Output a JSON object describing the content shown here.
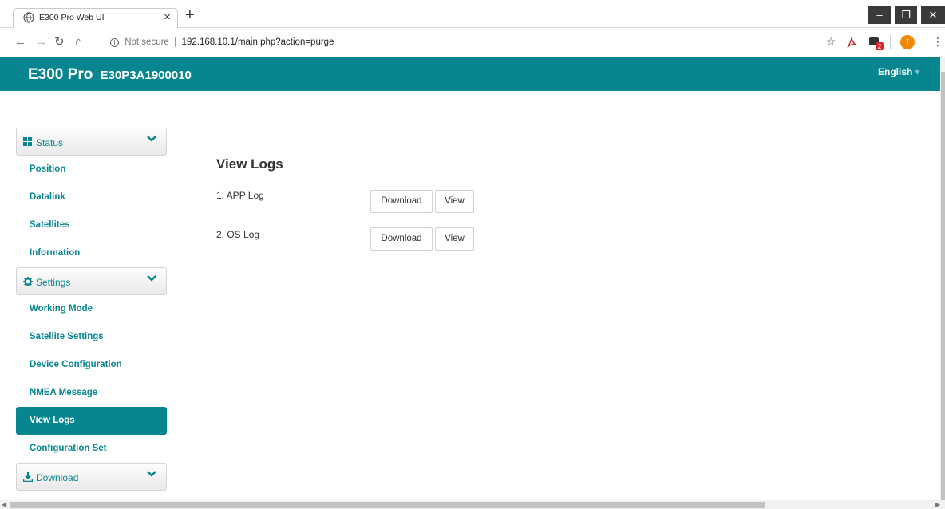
{
  "browser": {
    "tab_title": "E300 Pro Web UI",
    "tab_close": "×",
    "new_tab": "+",
    "security_label": "Not secure",
    "url": "192.168.10.1/main.php?action=purge",
    "bookmark_icon": "star-icon",
    "extension_badge": "2",
    "profile_initial": "f"
  },
  "header": {
    "product": "E300 Pro",
    "serial": "E30P3A1900010",
    "language": "English"
  },
  "sidebar": {
    "status": {
      "label": "Status",
      "items": [
        "Position",
        "Datalink",
        "Satellites",
        "Information"
      ]
    },
    "settings": {
      "label": "Settings",
      "items": [
        "Working Mode",
        "Satellite Settings",
        "Device Configuration",
        "NMEA Message",
        "View Logs",
        "Configuration Set"
      ],
      "active": "View Logs"
    },
    "download": {
      "label": "Download"
    }
  },
  "main": {
    "title": "View Logs",
    "logs": [
      {
        "label": "1. APP Log",
        "download": "Download",
        "view": "View"
      },
      {
        "label": "2. OS Log",
        "download": "Download",
        "view": "View"
      }
    ]
  },
  "colors": {
    "accent": "#08868f",
    "text": "#333333"
  }
}
